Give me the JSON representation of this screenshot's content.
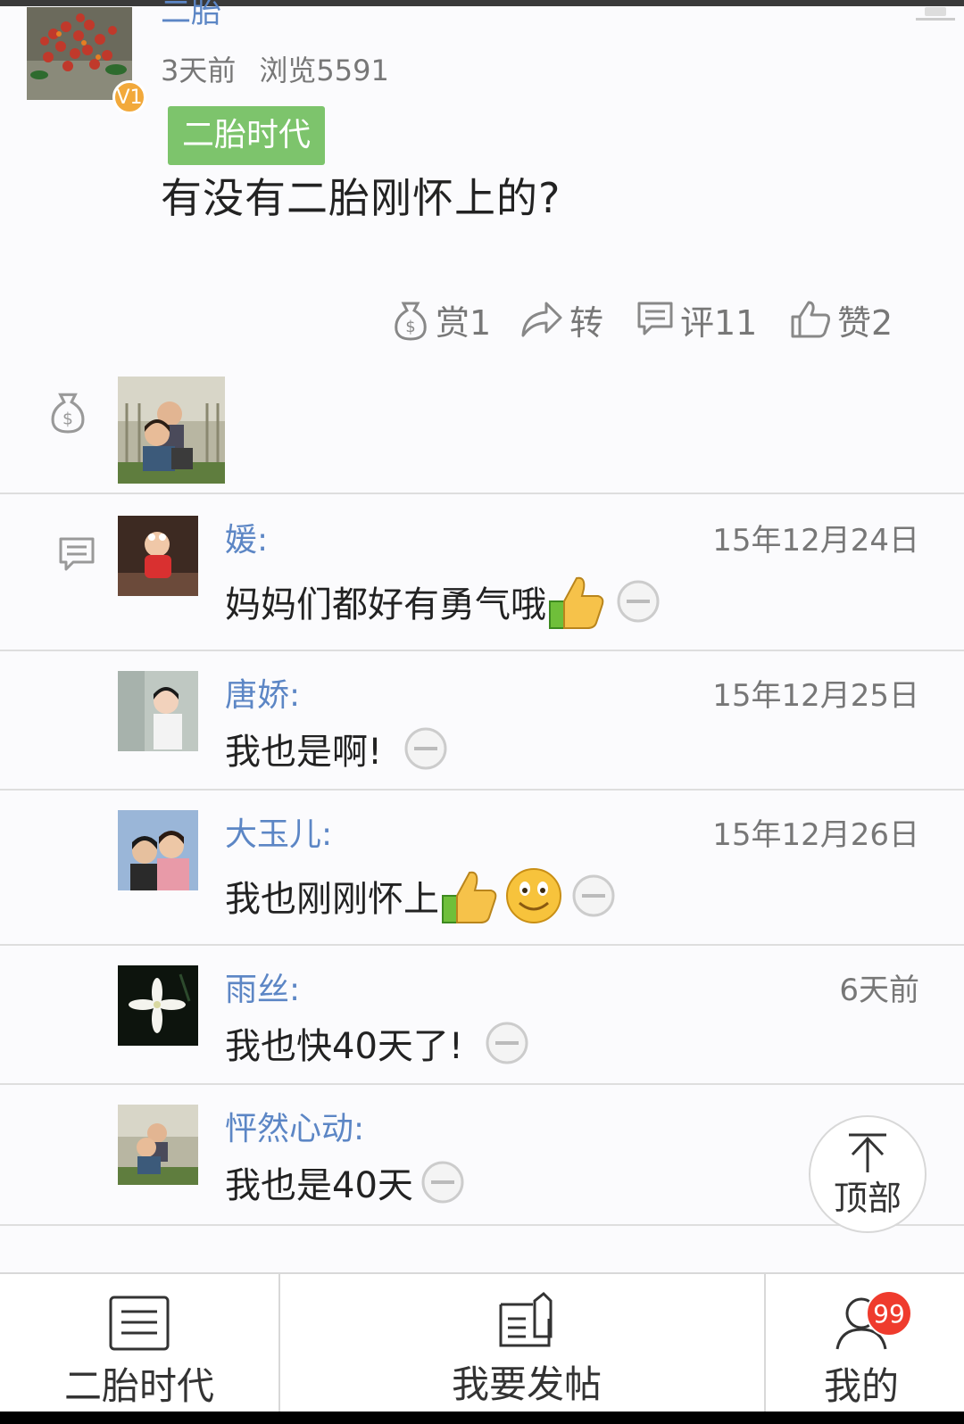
{
  "post": {
    "author": "二胎",
    "badge": "V1",
    "time": "3天前",
    "views": "浏览5591",
    "tag": "二胎时代",
    "title": "有没有二胎刚怀上的?"
  },
  "actions": {
    "reward": "赏1",
    "forward": "转",
    "comment": "评11",
    "like": "赞2"
  },
  "comments": [
    {
      "name": "媛:",
      "date": "15年12月24日",
      "text": "妈妈们都好有勇气哦",
      "emojis": [
        "thumbs-up"
      ]
    },
    {
      "name": "唐娇:",
      "date": "15年12月25日",
      "text": "我也是啊!",
      "emojis": []
    },
    {
      "name": "大玉儿:",
      "date": "15年12月26日",
      "text": "我也刚刚怀上",
      "emojis": [
        "thumbs-up",
        "smile"
      ]
    },
    {
      "name": "雨丝:",
      "date": "6天前",
      "text": "我也快40天了!",
      "emojis": []
    },
    {
      "name": "怦然心动:",
      "date": "",
      "text": "我也是40天",
      "emojis": []
    }
  ],
  "top_button": {
    "label": "顶部"
  },
  "bottom_nav": {
    "items": [
      {
        "label": "二胎时代",
        "icon": "list-icon"
      },
      {
        "label": "我要发帖",
        "icon": "compose-icon"
      },
      {
        "label": "我的",
        "icon": "user-icon"
      }
    ],
    "badge": "99"
  },
  "colors": {
    "link": "#5c86c5",
    "tag": "#7dc46c",
    "badge": "#ef3b2d",
    "v_badge": "#f2a93b"
  }
}
